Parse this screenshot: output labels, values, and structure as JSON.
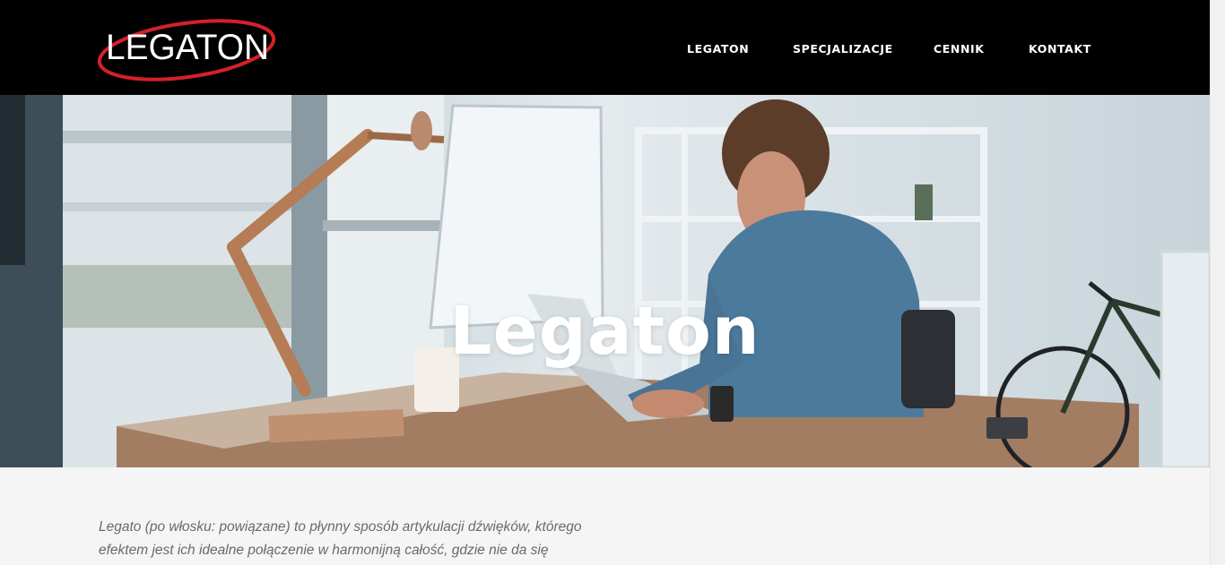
{
  "brand": {
    "logo_text": "LEGATON",
    "accent": "#d5202a"
  },
  "nav": {
    "items": [
      "LEGATON",
      "SPECJALIZACJE",
      "CENNIK",
      "KONTAKT"
    ]
  },
  "hero": {
    "title": "Legaton"
  },
  "content": {
    "line1": "Legato (po włosku: powiązane) to płynny sposób artykulacji dźwięków, którego",
    "line2": "efektem jest ich idealne połączenie w harmonijną całość, gdzie nie da się"
  },
  "colors": {
    "header_bg": "#000000",
    "page_bg": "#f5f5f5",
    "text_muted": "#6a6a6a"
  }
}
